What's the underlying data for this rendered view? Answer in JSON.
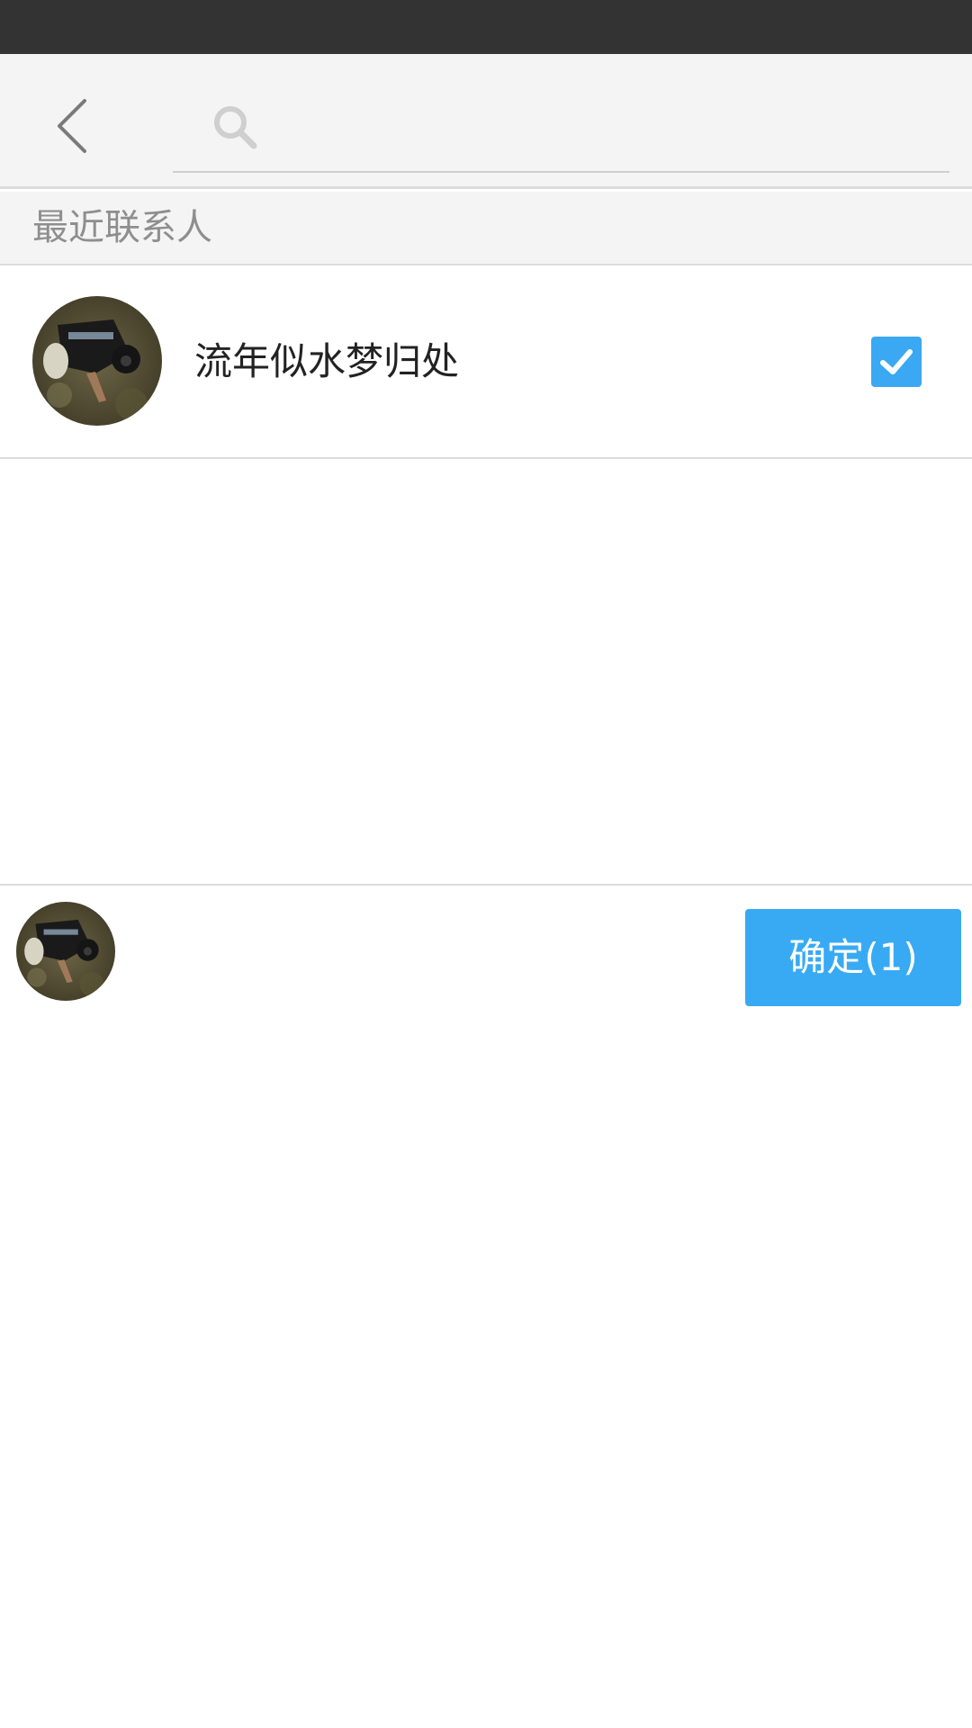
{
  "search": {
    "value": "",
    "placeholder": ""
  },
  "section": {
    "title": "最近联系人"
  },
  "contacts": [
    {
      "name": "流年似水梦归处",
      "selected": true
    }
  ],
  "bottom_bar": {
    "confirm_label": "确定(1)"
  },
  "icons": {
    "back": "back-arrow-icon",
    "search": "search-icon",
    "check": "check-icon"
  },
  "colors": {
    "status_bar": "#333333",
    "app_bar": "#f4f4f4",
    "accent": "#38aaf4",
    "section_text": "#8e8e8e"
  }
}
